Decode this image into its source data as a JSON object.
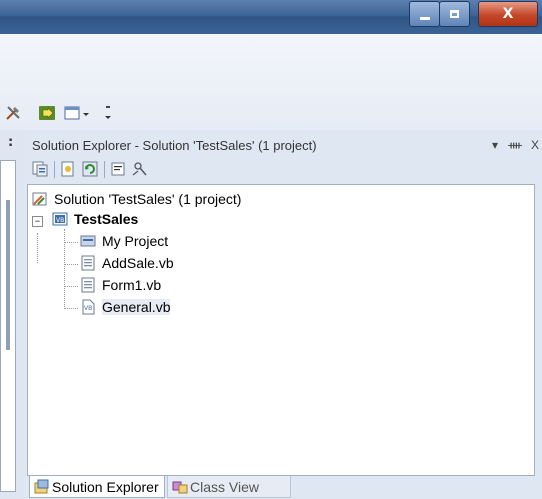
{
  "window": {
    "buttons": {
      "minimize": "minimize",
      "maximize": "maximize",
      "close": "X"
    }
  },
  "toolbar": {
    "icons": [
      "tools-icon",
      "run-icon",
      "window-icon",
      "dropdown-arrow-icon",
      "toolbar-grip-icon"
    ]
  },
  "left_pane": {
    "marker": ":"
  },
  "solution_explorer": {
    "title": "Solution Explorer - Solution 'TestSales' (1 project)",
    "header_buttons": {
      "dropdown": "▾",
      "pin": "ᚓ",
      "close": "X"
    },
    "toolbar_icons": [
      "properties-icon",
      "show-all-files-icon",
      "refresh-icon",
      "view-code-icon",
      "view-designer-icon"
    ],
    "tree": {
      "solution": "Solution 'TestSales' (1 project)",
      "project": "TestSales",
      "expander": "−",
      "items": [
        {
          "label": "My Project",
          "icon": "my-project-icon"
        },
        {
          "label": "AddSale.vb",
          "icon": "form-icon"
        },
        {
          "label": "Form1.vb",
          "icon": "form-icon"
        },
        {
          "label": "General.vb",
          "icon": "vb-module-icon",
          "selected": true
        }
      ]
    },
    "tabs": [
      {
        "label": "Solution Explorer",
        "active": true
      },
      {
        "label": "Class View",
        "active": false
      }
    ]
  }
}
